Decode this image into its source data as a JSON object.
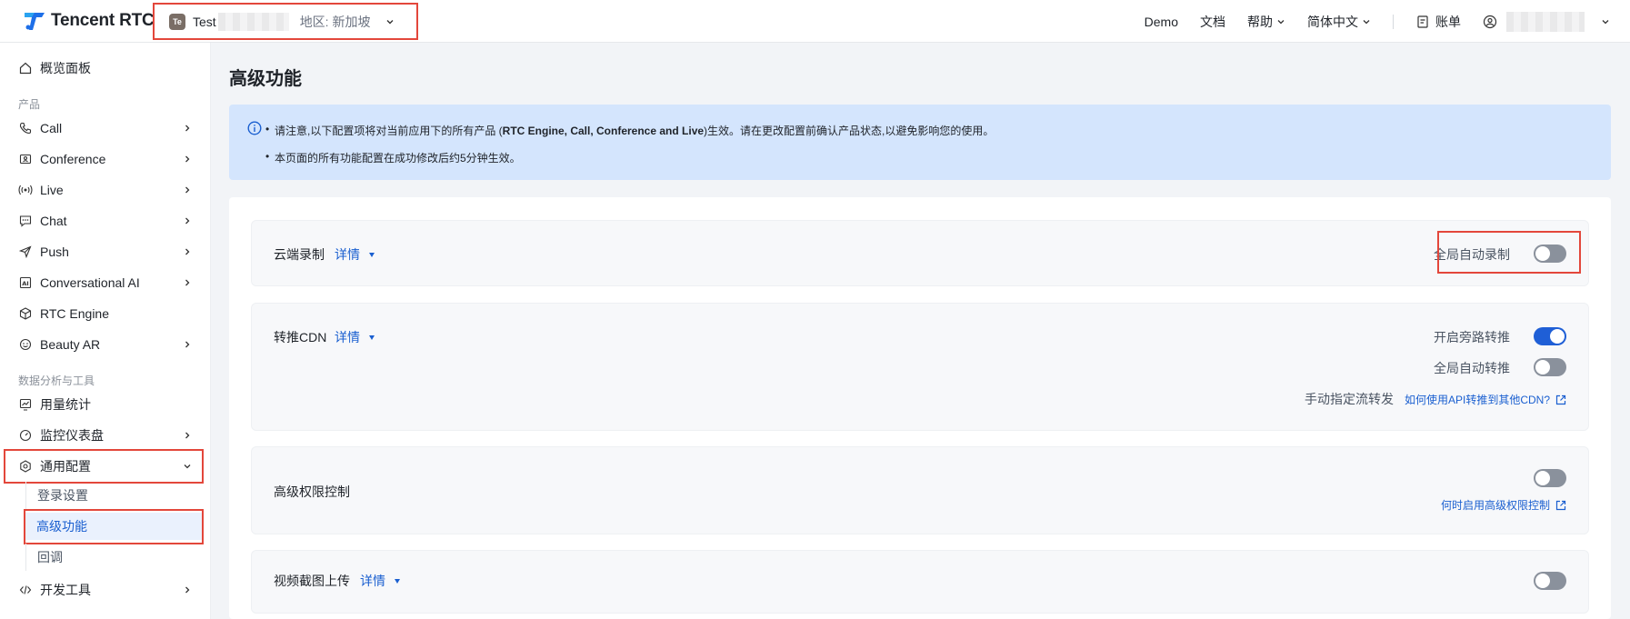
{
  "header": {
    "logo_text": "Tencent RTC",
    "app_badge": "Te",
    "app_name": "Test",
    "region": "地区: 新加坡",
    "nav": {
      "demo": "Demo",
      "docs": "文档",
      "help": "帮助",
      "language": "简体中文",
      "billing": "账单"
    }
  },
  "sidebar": {
    "overview": "概览面板",
    "group_products": "产品",
    "products": [
      "Call",
      "Conference",
      "Live",
      "Chat",
      "Push",
      "Conversational AI",
      "RTC Engine",
      "Beauty AR"
    ],
    "group_tools": "数据分析与工具",
    "usage": "用量统计",
    "monitor": "监控仪表盘",
    "general": "通用配置",
    "sub": [
      "登录设置",
      "高级功能",
      "回调"
    ],
    "devtools": "开发工具"
  },
  "main": {
    "title": "高级功能",
    "notice": {
      "line1_pre": "请注意,以下配置项将对当前应用下的所有产品 (",
      "line1_bold": "RTC Engine, Call, Conference and Live",
      "line1_post": ")生效。请在更改配置前确认产品状态,以避免影响您的使用。",
      "line2": "本页面的所有功能配置在成功修改后约5分钟生效。"
    },
    "detail_label": "详情",
    "cloud_recording": {
      "title": "云端录制",
      "auto_record_label": "全局自动录制",
      "auto_record_on": false
    },
    "cdn": {
      "title": "转推CDN",
      "bypass_label": "开启旁路转推",
      "bypass_on": true,
      "auto_push_label": "全局自动转推",
      "auto_push_on": false,
      "manual_label": "手动指定流转发",
      "manual_link": "如何使用API转推到其他CDN?"
    },
    "permission": {
      "title": "高级权限控制",
      "enabled": false,
      "link": "何时启用高级权限控制"
    },
    "snapshot": {
      "title": "视频截图上传",
      "enabled": false
    }
  },
  "colors": {
    "accent": "#1f5fd6",
    "highlight": "#e3473b",
    "notice_bg": "#d4e5fd"
  }
}
